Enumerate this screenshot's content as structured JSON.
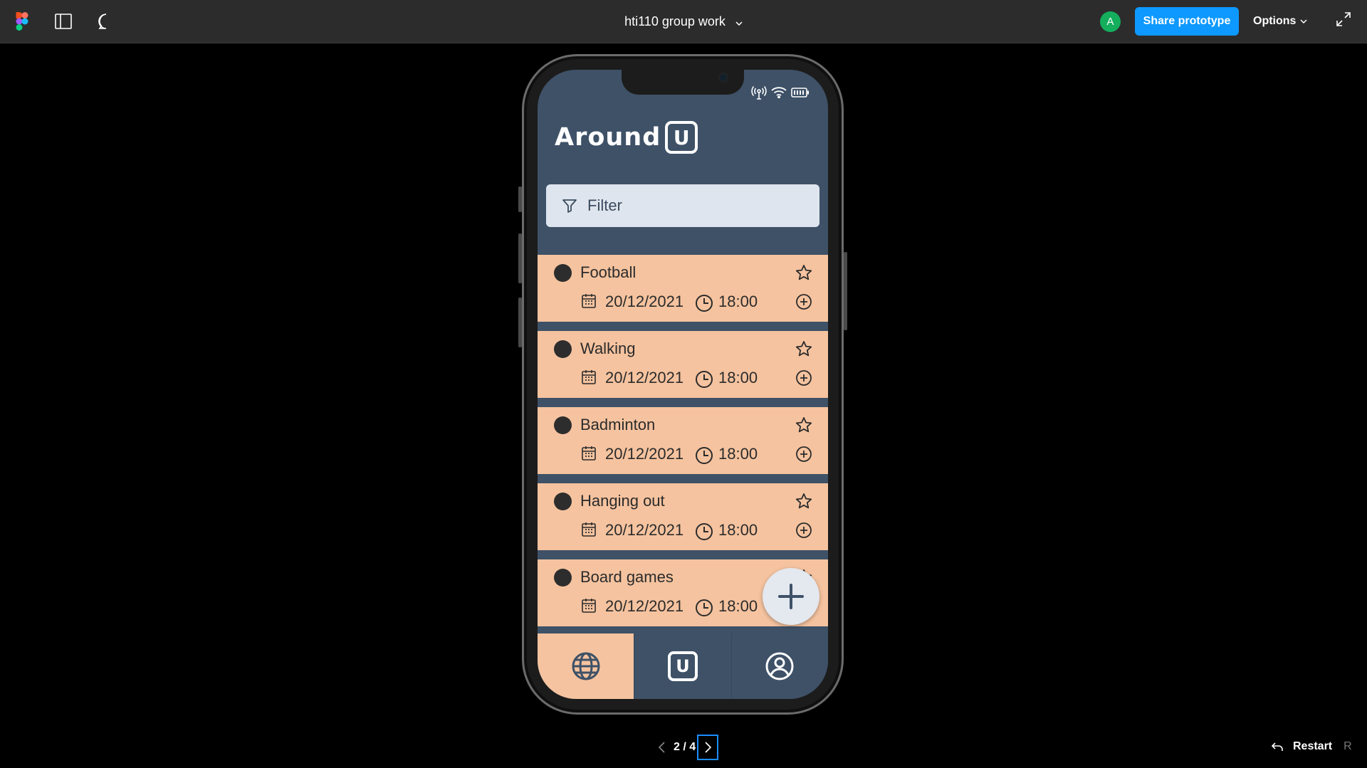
{
  "toolbar": {
    "title": "hti110 group work",
    "avatar_initial": "A",
    "share_label": "Share prototype",
    "options_label": "Options",
    "accent": "#0d99ff",
    "avatar_color": "#14ae5c"
  },
  "app": {
    "logo_text": "Around",
    "logo_letter": "U",
    "filter_placeholder": "Filter",
    "card_color": "#f5c39f",
    "background": "#3e5167",
    "events": [
      {
        "name": "Football",
        "date": "20/12/2021",
        "time": "18:00"
      },
      {
        "name": "Walking",
        "date": "20/12/2021",
        "time": "18:00"
      },
      {
        "name": "Badminton",
        "date": "20/12/2021",
        "time": "18:00"
      },
      {
        "name": "Hanging out",
        "date": "20/12/2021",
        "time": "18:00"
      },
      {
        "name": "Board games",
        "date": "20/12/2021",
        "time": "18:00"
      }
    ],
    "nav": {
      "items": [
        "globe-icon",
        "around-u-icon",
        "profile-icon"
      ],
      "nav_letter": "U",
      "active_index": 0
    }
  },
  "pager": {
    "current": "2",
    "total": "4",
    "separator": " / "
  },
  "restart": {
    "label": "Restart",
    "shortcut": "R"
  }
}
